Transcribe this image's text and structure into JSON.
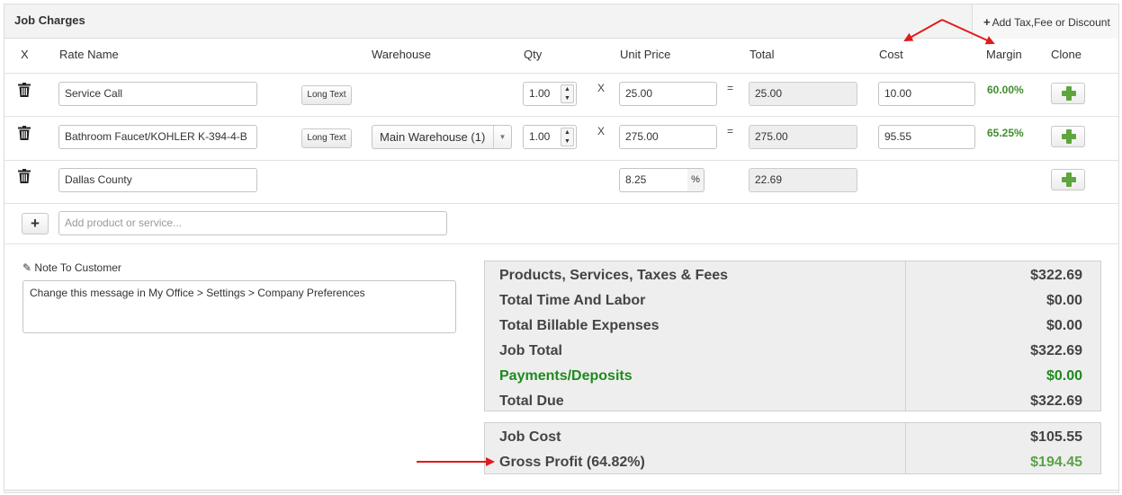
{
  "header": {
    "title": "Job Charges",
    "add_button": "Add Tax,Fee or Discount"
  },
  "columns": {
    "x": "X",
    "rate_name": "Rate Name",
    "warehouse": "Warehouse",
    "qty": "Qty",
    "unit_price": "Unit Price",
    "total": "Total",
    "cost": "Cost",
    "margin": "Margin",
    "clone": "Clone"
  },
  "rows": [
    {
      "rate_name": "Service Call",
      "long_text_label": "Long Text",
      "qty": "1.00",
      "times": "X",
      "unit_price": "25.00",
      "equals": "=",
      "total": "25.00",
      "cost": "10.00",
      "margin": "60.00%"
    },
    {
      "rate_name": "Bathroom Faucet/KOHLER  K-394-4-B",
      "long_text_label": "Long Text",
      "warehouse": "Main Warehouse (1)",
      "qty": "1.00",
      "times": "X",
      "unit_price": "275.00",
      "equals": "=",
      "total": "275.00",
      "cost": "95.55",
      "margin": "65.25%"
    },
    {
      "rate_name": "Dallas County",
      "unit_price": "8.25",
      "percent": "%",
      "total": "22.69"
    }
  ],
  "add_product": {
    "button": "+",
    "placeholder": "Add product or service..."
  },
  "note": {
    "label": "Note To Customer",
    "text": "Change this message in My Office > Settings > Company Preferences"
  },
  "summary": [
    {
      "label": "Products, Services, Taxes & Fees",
      "value": "$322.69"
    },
    {
      "label": "Total Time And Labor",
      "value": "$0.00"
    },
    {
      "label": "Total Billable Expenses",
      "value": "$0.00"
    },
    {
      "label": "Job Total",
      "value": "$322.69"
    },
    {
      "label": "Payments/Deposits",
      "value": "$0.00"
    },
    {
      "label": "Total Due",
      "value": "$322.69"
    }
  ],
  "cost_summary": [
    {
      "label": "Job Cost",
      "value": "$105.55"
    },
    {
      "label": "Gross Profit (64.82%)",
      "value": "$194.45"
    }
  ],
  "colors": {
    "margin_green": "#3e8e2e",
    "payments_green": "#1e8a1e",
    "profit_green": "#5ba247",
    "arrow_red": "#e01b1b"
  }
}
